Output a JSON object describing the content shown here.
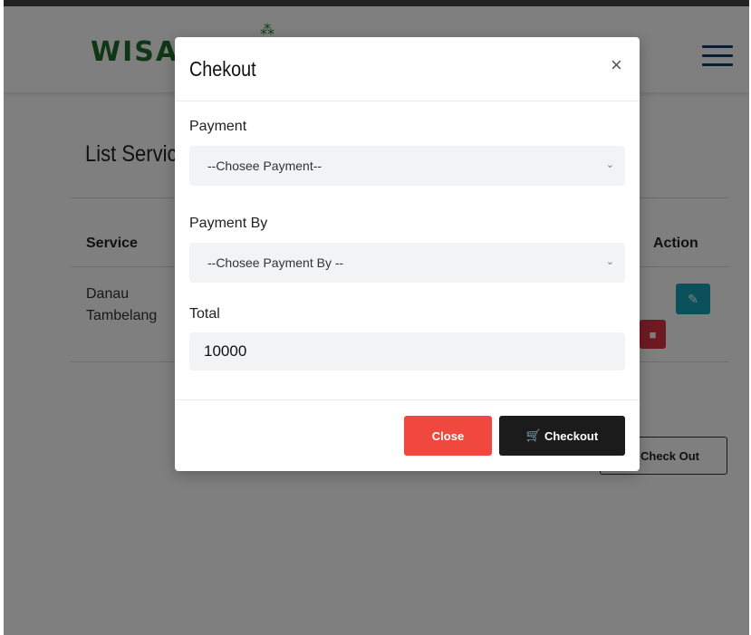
{
  "page": {
    "brand": "WISA",
    "brand_leaf_icon": "leaf-icon",
    "menu_icon": "hamburger-icon",
    "title": "List Servic",
    "table": {
      "headers": {
        "service": "Service",
        "action": "Action"
      },
      "rows": [
        {
          "service": "Danau Tambelang"
        }
      ]
    },
    "checkout_button_label": "Check Out",
    "edit_icon": "edit-icon",
    "delete_icon": "trash-icon"
  },
  "modal": {
    "title": "Chekout",
    "close_symbol": "×",
    "fields": {
      "payment": {
        "label": "Payment",
        "value": "--Chosee Payment--"
      },
      "payment_by": {
        "label": "Payment By",
        "value": "--Chosee Payment By --"
      },
      "total": {
        "label": "Total",
        "value": "10000"
      }
    },
    "buttons": {
      "close": "Close",
      "checkout": "Checkout"
    },
    "colors": {
      "close": "#f0483e",
      "checkout": "#1b1b1b"
    }
  }
}
